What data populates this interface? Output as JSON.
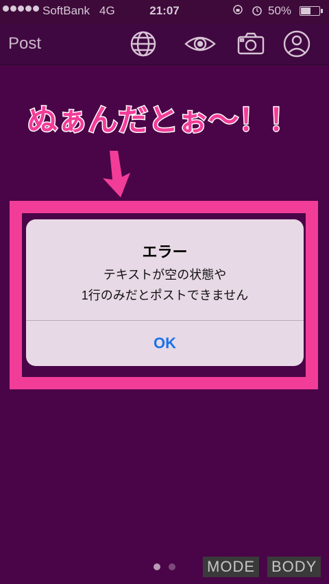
{
  "status_bar": {
    "carrier": "SoftBank",
    "network": "4G",
    "time": "21:07",
    "battery": "50%",
    "battery_level": 0.5
  },
  "nav": {
    "title": "Post",
    "icons": [
      "globe-icon",
      "eye-icon",
      "camera-icon",
      "profile-icon"
    ]
  },
  "annotation": {
    "caption": "ぬぁんだとぉ〜！！",
    "caption_color": "#f23d98",
    "frame_color": "#f23d98"
  },
  "alert": {
    "title": "エラー",
    "message_line1": "テキストが空の状態や",
    "message_line2": "1行のみだとポストできません",
    "ok_label": "OK"
  },
  "pager": {
    "pages": 2,
    "current": 1
  },
  "bottom_tags": {
    "mode": "MODE",
    "body": "BODY"
  }
}
